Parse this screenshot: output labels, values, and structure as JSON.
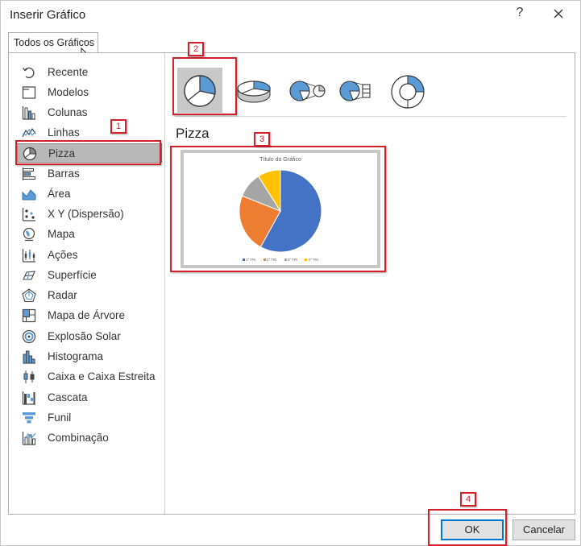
{
  "window": {
    "title": "Inserir Gráfico",
    "help_label": "?"
  },
  "tab": {
    "label": "Todos os Gráficos"
  },
  "sidebar": {
    "items": [
      {
        "label": "Recente",
        "icon": "recent-icon"
      },
      {
        "label": "Modelos",
        "icon": "templates-icon"
      },
      {
        "label": "Colunas",
        "icon": "column-chart-icon"
      },
      {
        "label": "Linhas",
        "icon": "line-chart-icon"
      },
      {
        "label": "Pizza",
        "icon": "pie-chart-icon",
        "selected": true
      },
      {
        "label": "Barras",
        "icon": "bar-chart-icon"
      },
      {
        "label": "Área",
        "icon": "area-chart-icon"
      },
      {
        "label": "X Y (Dispersão)",
        "icon": "scatter-chart-icon"
      },
      {
        "label": "Mapa",
        "icon": "map-chart-icon"
      },
      {
        "label": "Ações",
        "icon": "stock-chart-icon"
      },
      {
        "label": "Superfície",
        "icon": "surface-chart-icon"
      },
      {
        "label": "Radar",
        "icon": "radar-chart-icon"
      },
      {
        "label": "Mapa de Árvore",
        "icon": "treemap-chart-icon"
      },
      {
        "label": "Explosão Solar",
        "icon": "sunburst-chart-icon"
      },
      {
        "label": "Histograma",
        "icon": "histogram-chart-icon"
      },
      {
        "label": "Caixa e Caixa Estreita",
        "icon": "box-whisker-chart-icon"
      },
      {
        "label": "Cascata",
        "icon": "waterfall-chart-icon"
      },
      {
        "label": "Funil",
        "icon": "funnel-chart-icon"
      },
      {
        "label": "Combinação",
        "icon": "combo-chart-icon"
      }
    ]
  },
  "subtypes": [
    {
      "icon": "pie-subtype-icon",
      "selected": true
    },
    {
      "icon": "pie-3d-subtype-icon"
    },
    {
      "icon": "pie-of-pie-subtype-icon"
    },
    {
      "icon": "bar-of-pie-subtype-icon"
    },
    {
      "icon": "doughnut-subtype-icon"
    }
  ],
  "section": {
    "title": "Pizza"
  },
  "preview": {
    "title": "Título do Gráfico",
    "legend": [
      "1º TRI",
      "2º TRI",
      "3º TRI",
      "4º TRI"
    ]
  },
  "chart_data": {
    "type": "pie",
    "title": "Título do Gráfico",
    "categories": [
      "1º TRI",
      "2º TRI",
      "3º TRI",
      "4º TRI"
    ],
    "values": [
      58,
      23,
      10,
      9
    ],
    "colors": [
      "#4472c4",
      "#ed7d31",
      "#a5a5a5",
      "#ffc000"
    ]
  },
  "annotations": [
    "1",
    "2",
    "3",
    "4"
  ],
  "buttons": {
    "ok": "OK",
    "cancel": "Cancelar"
  },
  "colors": {
    "annotation_red": "#d4202a",
    "ok_border": "#0078d7",
    "selection_gray": "#b8b8b8"
  }
}
